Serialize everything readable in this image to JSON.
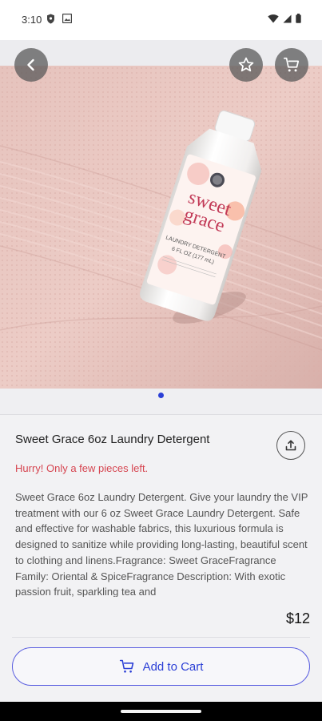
{
  "status_bar": {
    "time": "3:10"
  },
  "product": {
    "title": "Sweet Grace 6oz Laundry Detergent",
    "stock_note": "Hurry! Only a few pieces left.",
    "description": "Sweet Grace 6oz Laundry Detergent. Give your laundry the VIP treatment with our 6 oz Sweet Grace Laundry Detergent. Safe and effective for washable fabrics, this luxurious formula is designed to sanitize while providing long-lasting, beautiful scent to clothing and linens.Fragrance: Sweet GraceFragrance Family: Oriental & SpiceFragrance Description: With exotic passion fruit, sparkling tea and",
    "price": "$12"
  },
  "bottle_label": {
    "brand_top": "sweet",
    "brand_bottom": "grace",
    "line1": "LAUNDRY DETERGENT",
    "line2": "6 FL OZ (177 mL)"
  },
  "actions": {
    "add_to_cart_label": "Add to Cart"
  },
  "icons": {
    "back": "back-arrow-icon",
    "favorite": "star-icon",
    "cart": "cart-icon",
    "share": "share-icon"
  },
  "carousel": {
    "current_page": 1
  },
  "colors": {
    "accent": "#2b3fd6",
    "warning": "#d64550"
  }
}
